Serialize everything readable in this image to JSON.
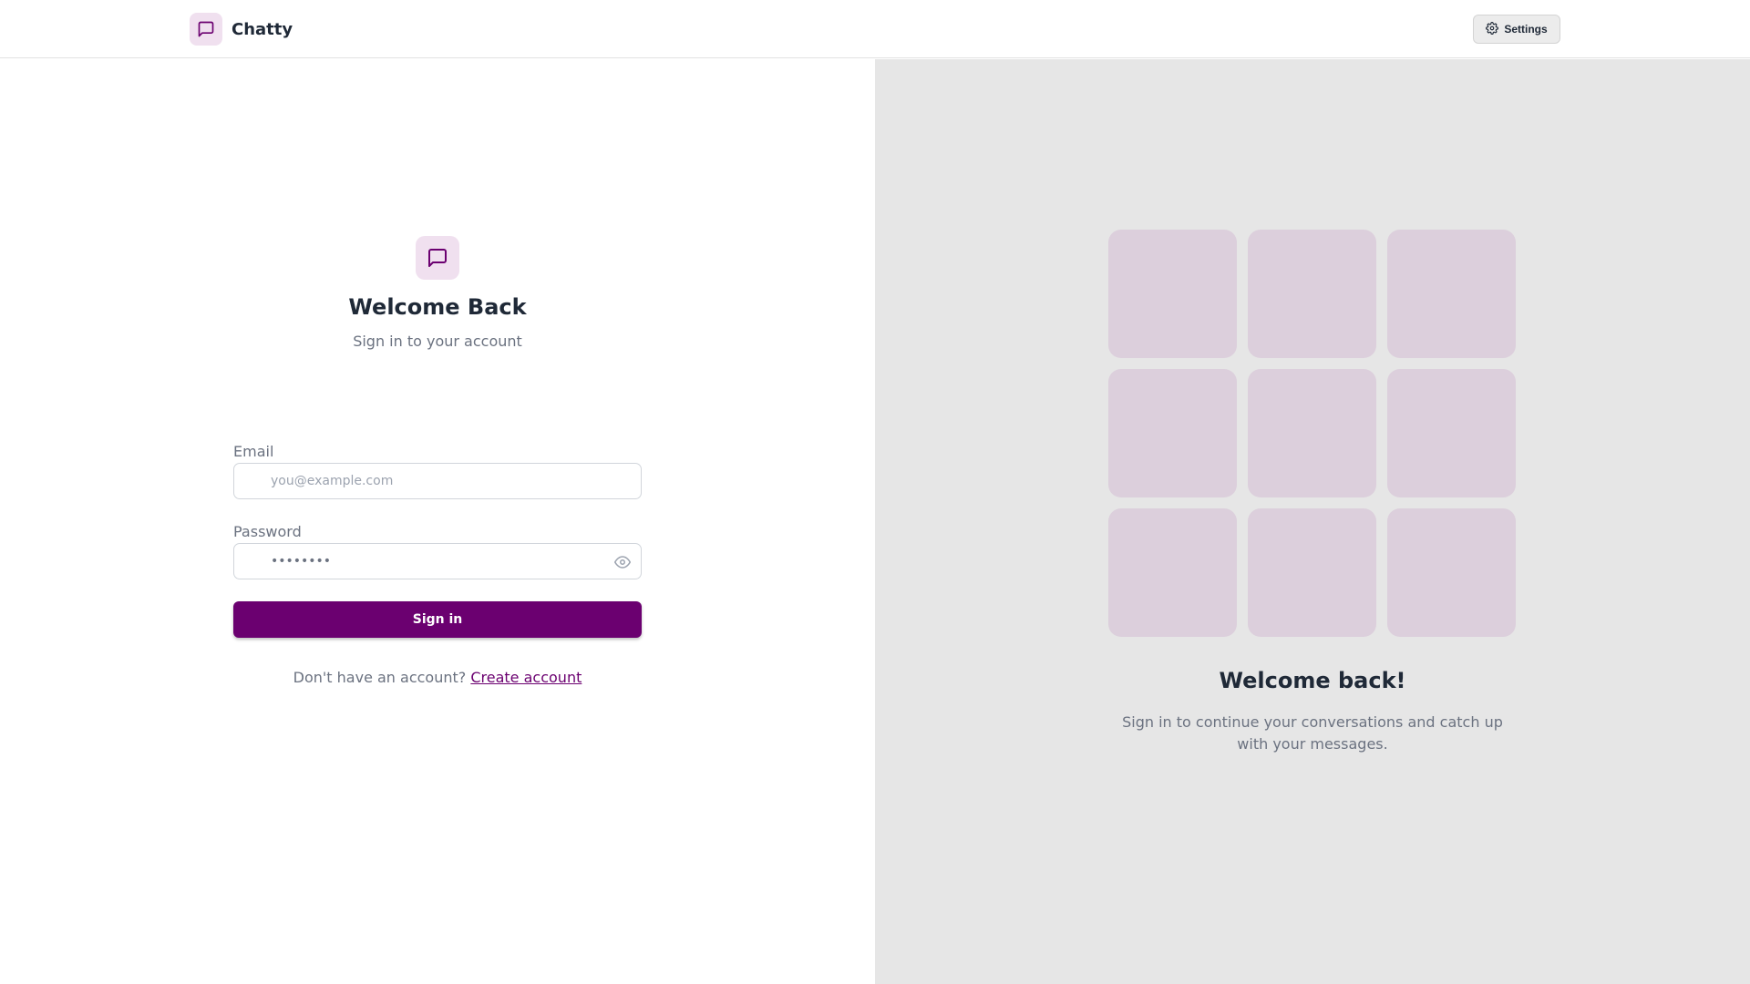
{
  "header": {
    "brand_name": "Chatty",
    "brand_icon": "message-square-icon",
    "settings_label": "Settings",
    "settings_icon": "gear-icon"
  },
  "login": {
    "logo_icon": "message-square-icon",
    "title": "Welcome Back",
    "subtitle": "Sign in to your account",
    "email": {
      "label": "Email",
      "placeholder": "you@example.com",
      "icon": "mail-icon"
    },
    "password": {
      "label": "Password",
      "value": "••••••••",
      "icon": "lock-icon",
      "toggle_icon": "eye-icon"
    },
    "submit_label": "Sign in",
    "signup_prompt": "Don't have an account?",
    "signup_link": "Create account"
  },
  "promo": {
    "tile_count": 9,
    "title": "Welcome back!",
    "text": "Sign in to continue your conversations and catch up with your messages."
  },
  "colors": {
    "primary": "#6b0070",
    "primary_soft": "#f0e0ef",
    "tile": "#dccfdc",
    "panel_bg": "#e6e6e6"
  }
}
